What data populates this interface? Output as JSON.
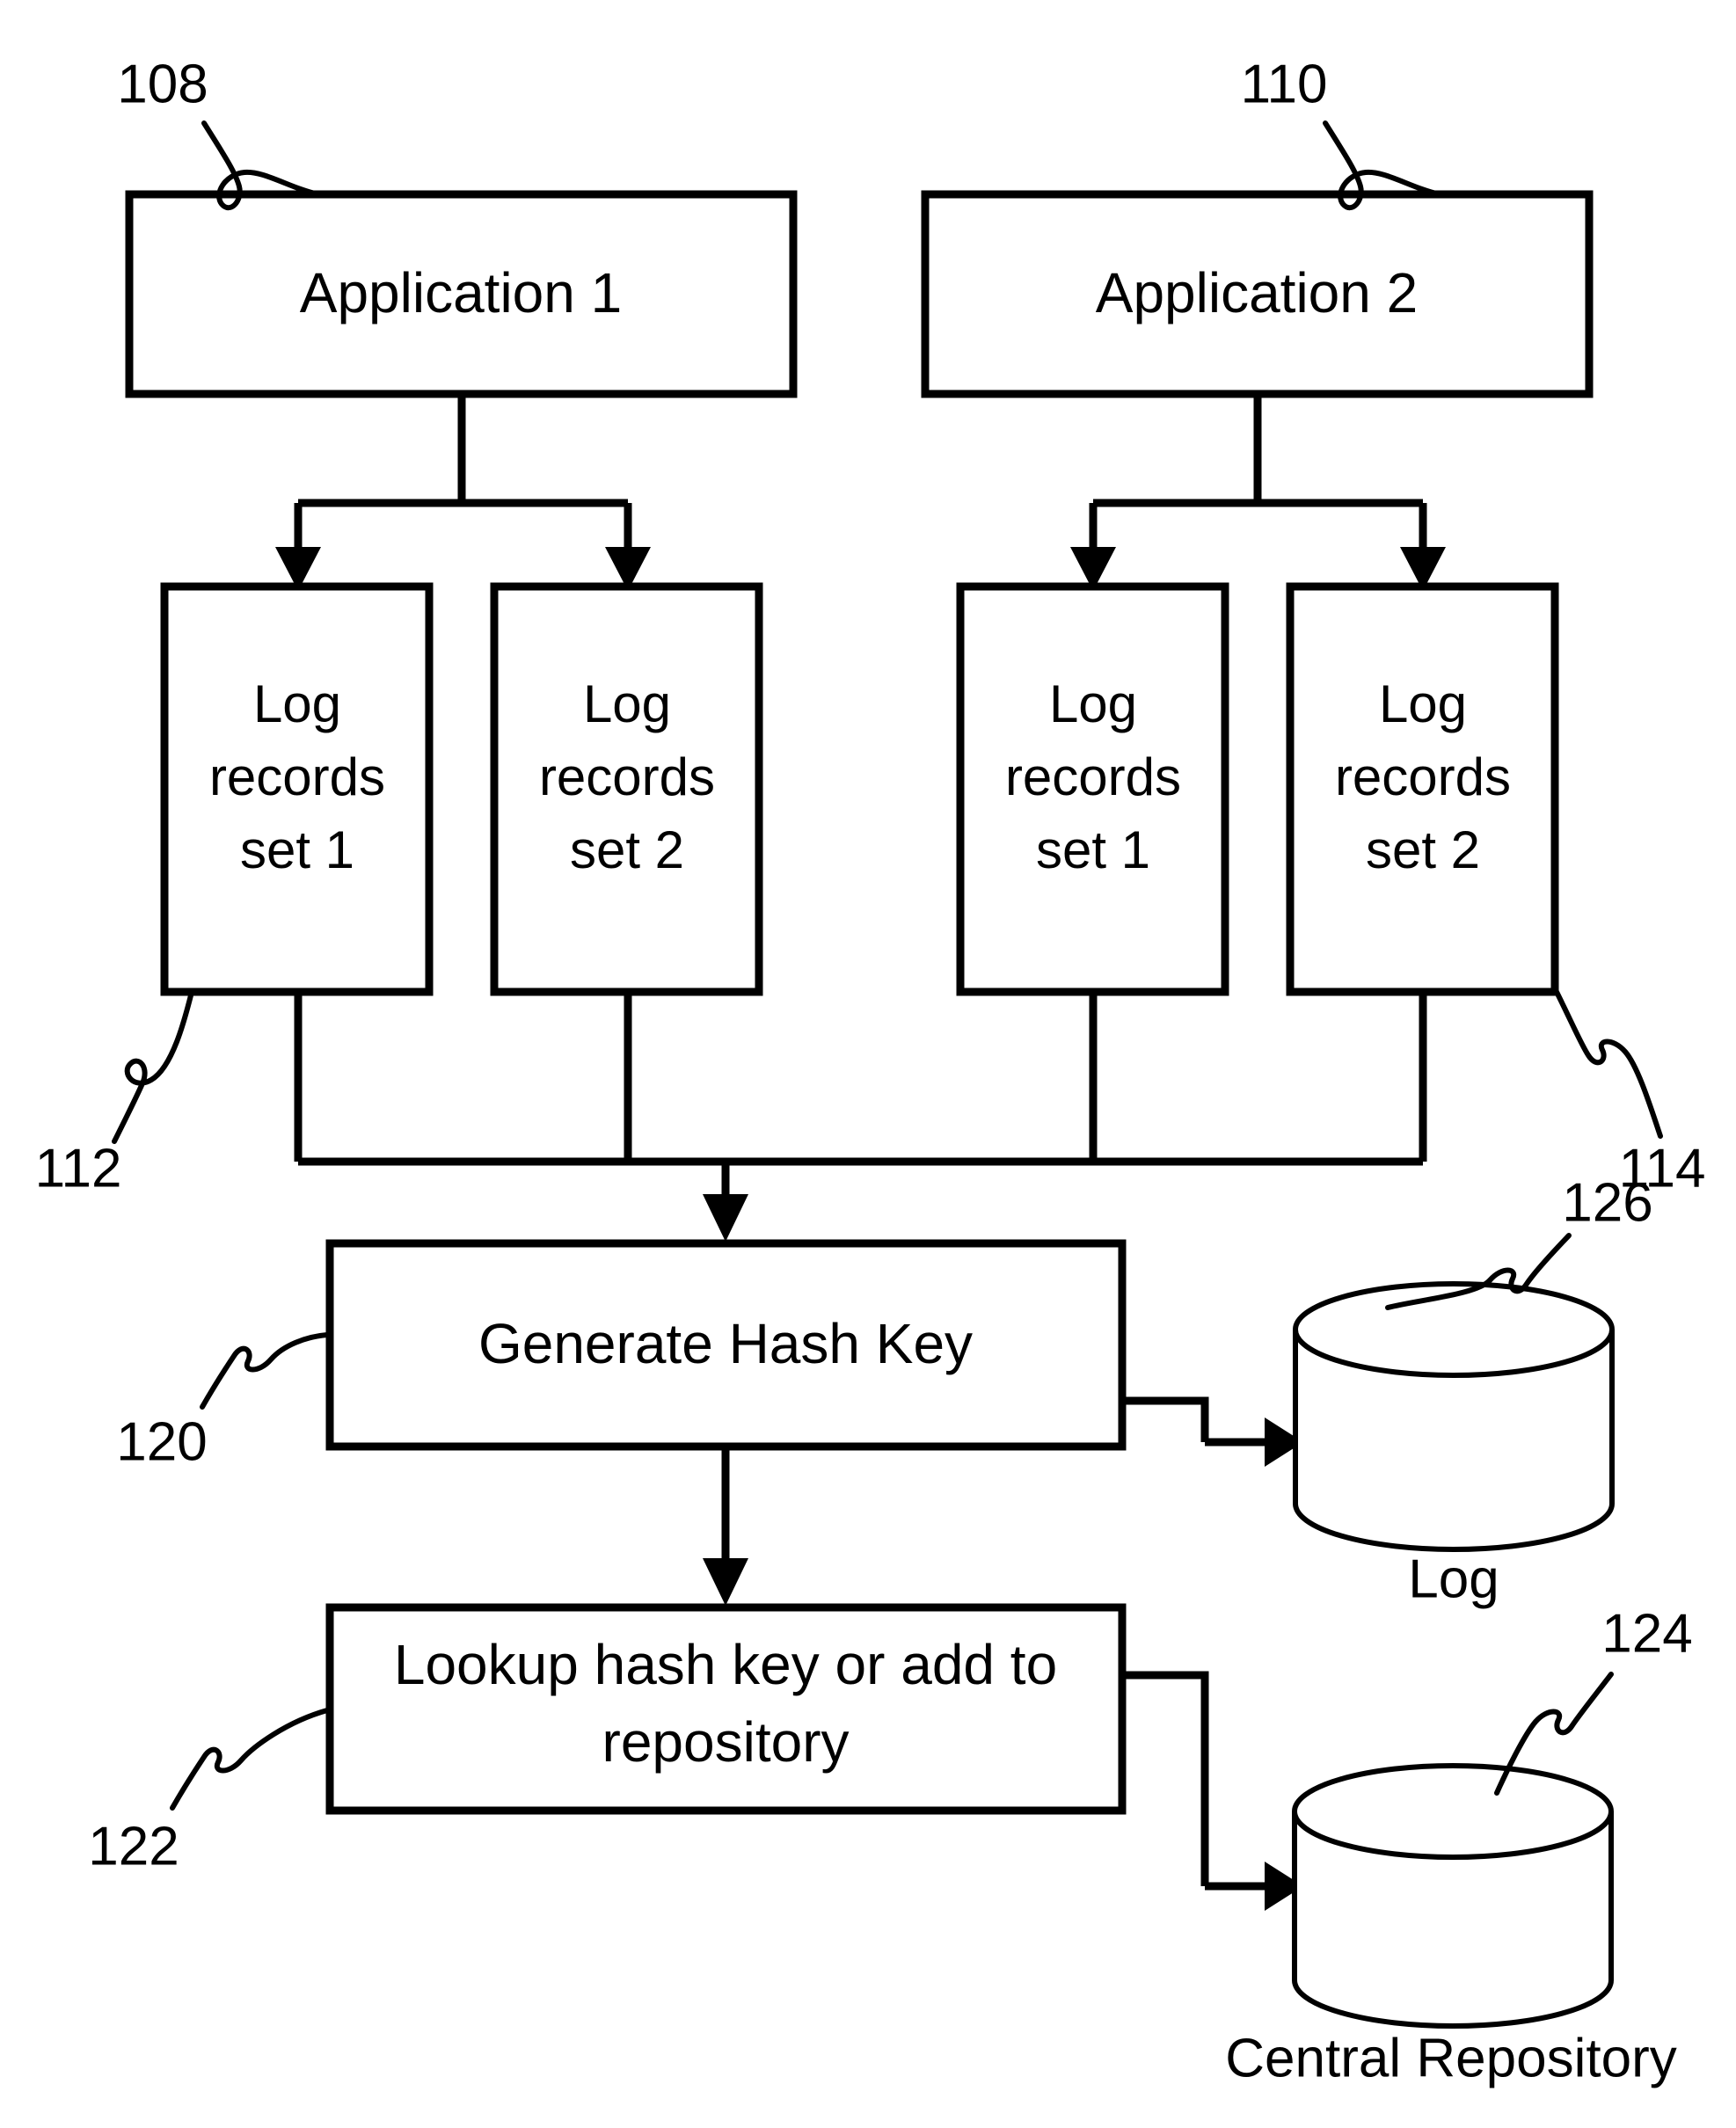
{
  "figure": {
    "type": "patent-flow-diagram",
    "background_color": "#ffffff",
    "stroke_color": "#000000"
  },
  "boxes": {
    "application_1": {
      "label": "Application 1",
      "ref": "108"
    },
    "application_2": {
      "label": "Application 2",
      "ref": "110"
    },
    "log_a1_set1": {
      "line1": "Log",
      "line2": "records",
      "line3": "set 1",
      "ref": "112"
    },
    "log_a1_set2": {
      "line1": "Log",
      "line2": "records",
      "line3": "set 2"
    },
    "log_a2_set1": {
      "line1": "Log",
      "line2": "records",
      "line3": "set 1"
    },
    "log_a2_set2": {
      "line1": "Log",
      "line2": "records",
      "line3": "set 2",
      "ref": "114"
    },
    "generate_hash_key": {
      "label": "Generate Hash Key",
      "ref": "120"
    },
    "lookup_hash_key": {
      "line1": "Lookup hash key or add to",
      "line2": "repository",
      "ref": "122"
    }
  },
  "cylinders": {
    "log_store": {
      "caption": "Log",
      "ref": "126"
    },
    "central_repository": {
      "caption": "Central Repository",
      "ref": "124"
    }
  },
  "reference_numerals": {
    "n108": "108",
    "n110": "110",
    "n112": "112",
    "n114": "114",
    "n120": "120",
    "n122": "122",
    "n124": "124",
    "n126": "126"
  }
}
